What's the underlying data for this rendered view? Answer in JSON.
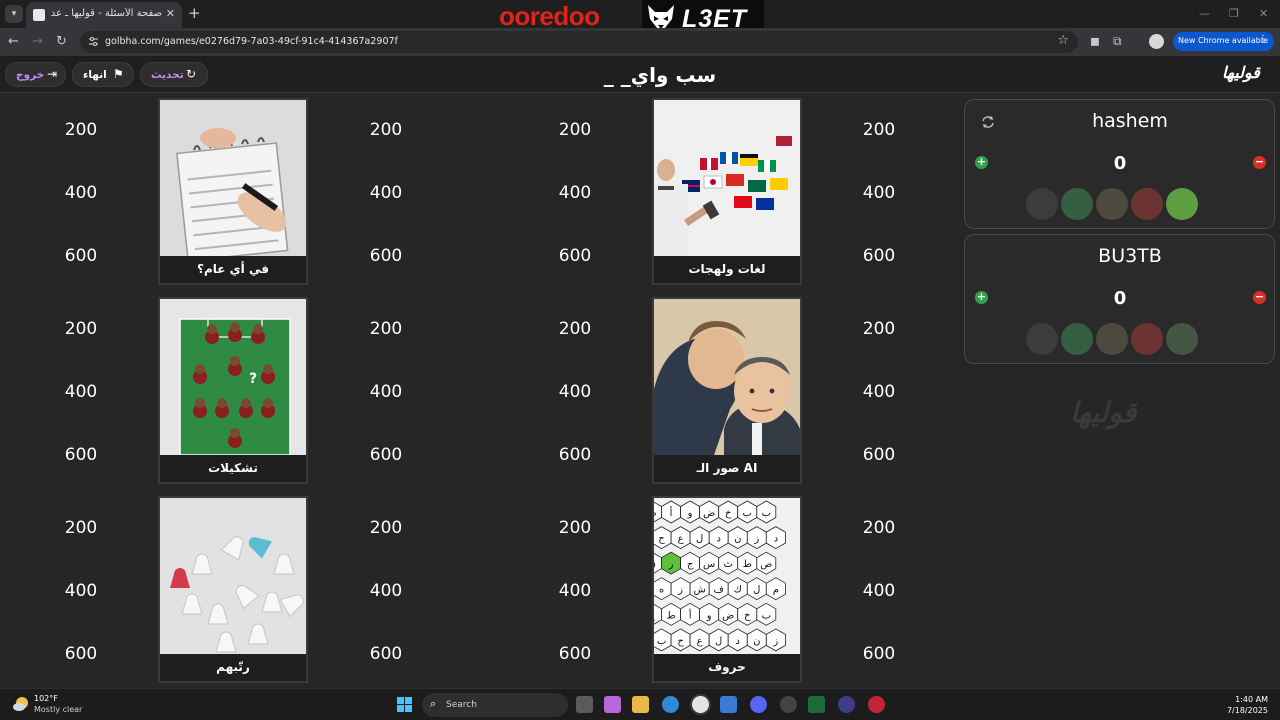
{
  "browser": {
    "tab_title": "صفحة الأسئلة - قوليها ـ عدل قبل",
    "new_tab": "+",
    "url": "golbha.com/games/e0276d79-7a03-49cf-91c4-414367a2907f",
    "new_chrome_label": "New Chrome available",
    "sponsor_left": "ooredoo",
    "sponsor_right": "L3ET"
  },
  "header": {
    "game_title": "_ _سب واي",
    "brand": "قوليها",
    "refresh_label": "تحديث",
    "finish_label": "انهاء",
    "exit_label": "خروج"
  },
  "board": {
    "point_values": [
      "200",
      "400",
      "600"
    ],
    "categories": [
      {
        "label": "في أي عام؟",
        "image": "calendar"
      },
      {
        "label": "لغات ولهجات",
        "image": "flags"
      },
      {
        "label": "تشكيلات",
        "image": "formation"
      },
      {
        "label": "صور الـ AI",
        "image": "portraits"
      },
      {
        "label": "رتّبهم",
        "image": "figures"
      },
      {
        "label": "حروف",
        "image": "letters-grid"
      }
    ]
  },
  "teams": [
    {
      "name": "hashem",
      "score": "0",
      "aids_active": true
    },
    {
      "name": "BU3TB",
      "score": "0",
      "aids_active": false
    }
  ],
  "taskbar": {
    "weather_temp": "102°F",
    "weather_desc": "Mostly clear",
    "search_label": "Search",
    "time": "1:40 AM",
    "date": "7/18/2025"
  },
  "colors": {
    "accent_purple": "#c58af9",
    "plus_green": "#31a24c",
    "minus_red": "#d93025",
    "chrome_blue": "#0b57d0",
    "ooredoo_red": "#e2231a"
  }
}
